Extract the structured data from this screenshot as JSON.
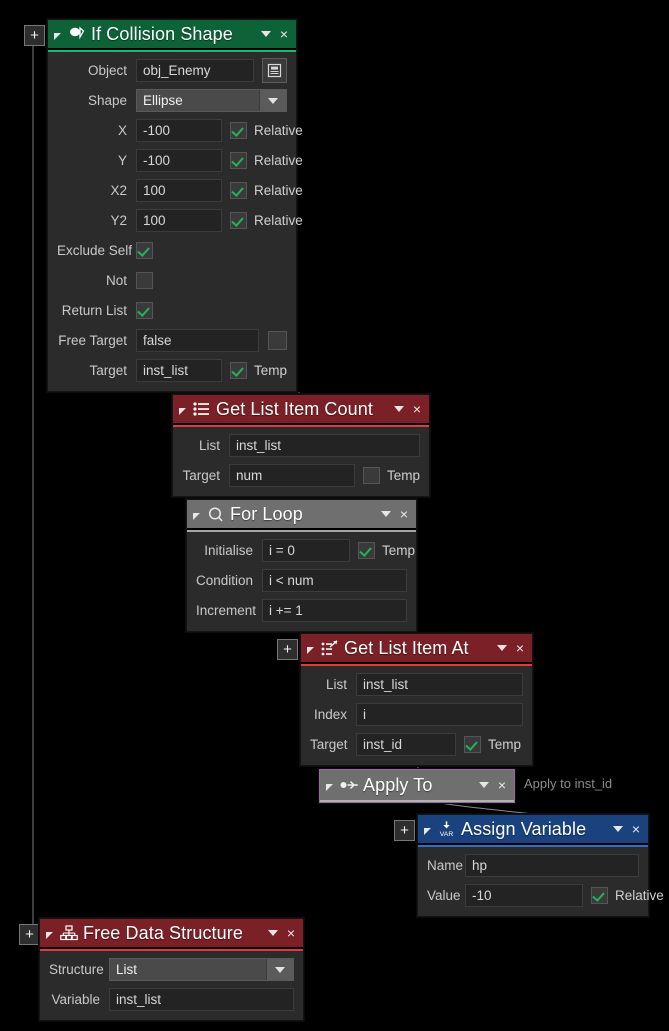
{
  "canvas": {
    "background": "#000000",
    "connector_green": "#2f6b3c",
    "connector_gray": "#8a8a8a",
    "sidebar_line": "#7a7a7a"
  },
  "buttons": {
    "add_label": "+"
  },
  "nodes": [
    {
      "id": "if-collision-shape",
      "title": "If Collision Shape",
      "icon": "collision-shape-icon",
      "header_color": "#0d6238",
      "accent_color": "#12c06a",
      "collapse_label": "◢",
      "menu_label": "▾",
      "close_label": "×",
      "rows": [
        {
          "label": "Object",
          "value": "obj_Enemy",
          "type": "text-with-button",
          "button": "object-picker-icon"
        },
        {
          "label": "Shape",
          "value": "Ellipse",
          "type": "dropdown"
        },
        {
          "label": "X",
          "value": "-100",
          "type": "text-with-check",
          "check_label": "Relative",
          "checked": true
        },
        {
          "label": "Y",
          "value": "-100",
          "type": "text-with-check",
          "check_label": "Relative",
          "checked": true
        },
        {
          "label": "X2",
          "value": "100",
          "type": "text-with-check",
          "check_label": "Relative",
          "checked": true
        },
        {
          "label": "Y2",
          "value": "100",
          "type": "text-with-check",
          "check_label": "Relative",
          "checked": true
        },
        {
          "label": "Exclude Self",
          "value": "",
          "type": "checkbox",
          "checked": true
        },
        {
          "label": "Not",
          "value": "",
          "type": "checkbox",
          "checked": false
        },
        {
          "label": "Return List",
          "value": "",
          "type": "checkbox",
          "checked": true
        },
        {
          "label": "Free Target",
          "value": "false",
          "type": "text-with-box"
        },
        {
          "label": "Target",
          "value": "inst_list",
          "type": "text-with-check",
          "check_label": "Temp",
          "checked": true
        }
      ]
    },
    {
      "id": "get-list-item-count",
      "title": "Get List Item Count",
      "icon": "list-count-icon",
      "header_color": "#7a2026",
      "accent_color": "#e03a3a",
      "collapse_label": "◢",
      "menu_label": "▾",
      "close_label": "×",
      "rows": [
        {
          "label": "List",
          "value": "inst_list",
          "type": "text"
        },
        {
          "label": "Target",
          "value": "num",
          "type": "text-with-check",
          "check_label": "Temp",
          "checked": false
        }
      ]
    },
    {
      "id": "for-loop",
      "title": "For Loop",
      "icon": "loop-icon",
      "header_color": "#6f6f6f",
      "accent_color": "#a6a6a6",
      "collapse_label": "◢",
      "menu_label": "▾",
      "close_label": "×",
      "rows": [
        {
          "label": "Initialise",
          "value": "i = 0",
          "type": "text-with-check",
          "check_label": "Temp",
          "checked": true
        },
        {
          "label": "Condition",
          "value": "i < num",
          "type": "text"
        },
        {
          "label": "Increment",
          "value": "i += 1",
          "type": "text"
        }
      ]
    },
    {
      "id": "get-list-item-at",
      "title": "Get List Item At",
      "icon": "list-item-at-icon",
      "header_color": "#7a2026",
      "accent_color": "#e03a3a",
      "collapse_label": "◢",
      "menu_label": "▾",
      "close_label": "×",
      "rows": [
        {
          "label": "List",
          "value": "inst_list",
          "type": "text"
        },
        {
          "label": "Index",
          "value": "i",
          "type": "text"
        },
        {
          "label": "Target",
          "value": "inst_id",
          "type": "text-with-check",
          "check_label": "Temp",
          "checked": true
        }
      ]
    },
    {
      "id": "apply-to",
      "title": "Apply To",
      "icon": "apply-to-icon",
      "header_color": "#6f6f6f",
      "accent_color": "#b2b2b2",
      "collapse_label": "◢",
      "menu_label": "▾",
      "close_label": "×",
      "selected_border": "#9a6a9e",
      "annotation": "Apply to inst_id",
      "rows": []
    },
    {
      "id": "assign-variable",
      "title": "Assign Variable",
      "icon": "variable-icon",
      "header_color": "#19427e",
      "accent_color": "#2f6fd0",
      "collapse_label": "◢",
      "menu_label": "▾",
      "close_label": "×",
      "rows": [
        {
          "label": "Name",
          "value": "hp",
          "type": "text"
        },
        {
          "label": "Value",
          "value": "-10",
          "type": "text-with-check",
          "check_label": "Relative",
          "checked": true
        }
      ]
    },
    {
      "id": "free-data-structure",
      "title": "Free Data Structure",
      "icon": "data-structure-icon",
      "header_color": "#7a2026",
      "accent_color": "#e03a3a",
      "collapse_label": "◢",
      "menu_label": "▾",
      "close_label": "×",
      "rows": [
        {
          "label": "Structure",
          "value": "List",
          "type": "dropdown"
        },
        {
          "label": "Variable",
          "value": "inst_list",
          "type": "text"
        }
      ]
    }
  ]
}
